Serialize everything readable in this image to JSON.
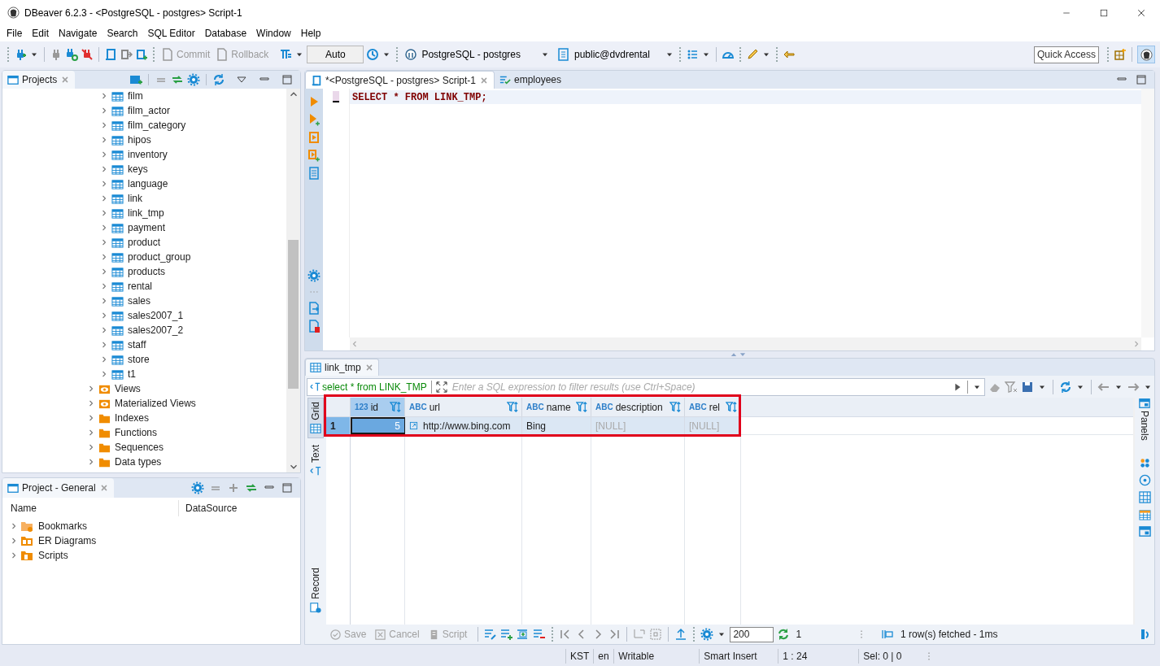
{
  "window": {
    "title": "DBeaver 6.2.3 - <PostgreSQL - postgres> Script-1"
  },
  "menu": [
    "File",
    "Edit",
    "Navigate",
    "Search",
    "SQL Editor",
    "Database",
    "Window",
    "Help"
  ],
  "toolbar": {
    "commit": "Commit",
    "rollback": "Rollback",
    "mode": "Auto",
    "connection": "PostgreSQL - postgres",
    "schema": "public@dvdrental",
    "quick_access": "Quick Access"
  },
  "projects_view": {
    "title": "Projects",
    "scrolled_group": {
      "children": [
        {
          "label": "film"
        },
        {
          "label": "film_actor"
        },
        {
          "label": "film_category"
        },
        {
          "label": "hipos"
        },
        {
          "label": "inventory"
        },
        {
          "label": "keys"
        },
        {
          "label": "language"
        },
        {
          "label": "link"
        },
        {
          "label": "link_tmp"
        },
        {
          "label": "payment"
        },
        {
          "label": "product"
        },
        {
          "label": "product_group"
        },
        {
          "label": "products"
        },
        {
          "label": "rental"
        },
        {
          "label": "sales"
        },
        {
          "label": "sales2007_1"
        },
        {
          "label": "sales2007_2"
        },
        {
          "label": "staff"
        },
        {
          "label": "store"
        },
        {
          "label": "t1"
        }
      ]
    },
    "items": [
      {
        "label": "Views",
        "kind": "view"
      },
      {
        "label": "Materialized Views",
        "kind": "view"
      },
      {
        "label": "Indexes",
        "kind": "folder"
      },
      {
        "label": "Functions",
        "kind": "folder"
      },
      {
        "label": "Sequences",
        "kind": "folder"
      },
      {
        "label": "Data types",
        "kind": "folder"
      }
    ]
  },
  "project_general": {
    "title": "Project - General",
    "columns": [
      "Name",
      "DataSource"
    ],
    "items": [
      {
        "label": "Bookmarks",
        "kind": "bookmarks"
      },
      {
        "label": "ER Diagrams",
        "kind": "diagrams"
      },
      {
        "label": "Scripts",
        "kind": "scripts"
      }
    ]
  },
  "editor": {
    "tabs": [
      {
        "label": "*<PostgreSQL - postgres> Script-1",
        "selected": true,
        "kind": "script"
      },
      {
        "label": "employees",
        "selected": false,
        "kind": "table"
      }
    ],
    "line": "SELECT * FROM LINK_TMP;"
  },
  "results": {
    "tab": "link_tmp",
    "query": "select * from LINK_TMP",
    "filter_placeholder": "Enter a SQL expression to filter results (use Ctrl+Space)",
    "side_tabs": [
      {
        "label": "Grid",
        "selected": true
      },
      {
        "label": "Text",
        "selected": false
      },
      {
        "label": "Record",
        "selected": false
      }
    ],
    "columns": [
      {
        "type_label": "123",
        "name": "id",
        "selected": true
      },
      {
        "type_label": "ABC",
        "name": "url",
        "selected": false
      },
      {
        "type_label": "ABC",
        "name": "name",
        "selected": false
      },
      {
        "type_label": "ABC",
        "name": "description",
        "selected": false
      },
      {
        "type_label": "ABC",
        "name": "rel",
        "selected": false
      }
    ],
    "rows": [
      {
        "number": "1",
        "cells": [
          {
            "text": "5",
            "kind": "number",
            "selected": true
          },
          {
            "text": "http://www.bing.com",
            "kind": "link",
            "selected": false
          },
          {
            "text": "Bing",
            "kind": "text",
            "selected": false
          },
          {
            "text": "[NULL]",
            "kind": "null",
            "selected": false
          },
          {
            "text": "[NULL]",
            "kind": "null",
            "selected": false
          }
        ]
      }
    ],
    "actions": [
      "Save",
      "Cancel",
      "Script"
    ],
    "fetch_size": "200",
    "refresh_count": "1",
    "status": "1 row(s) fetched - 1ms",
    "panels": "Panels"
  },
  "status_bar": [
    "KST",
    "en",
    "Writable",
    "Smart Insert",
    "1 : 24",
    "Sel: 0 | 0"
  ]
}
